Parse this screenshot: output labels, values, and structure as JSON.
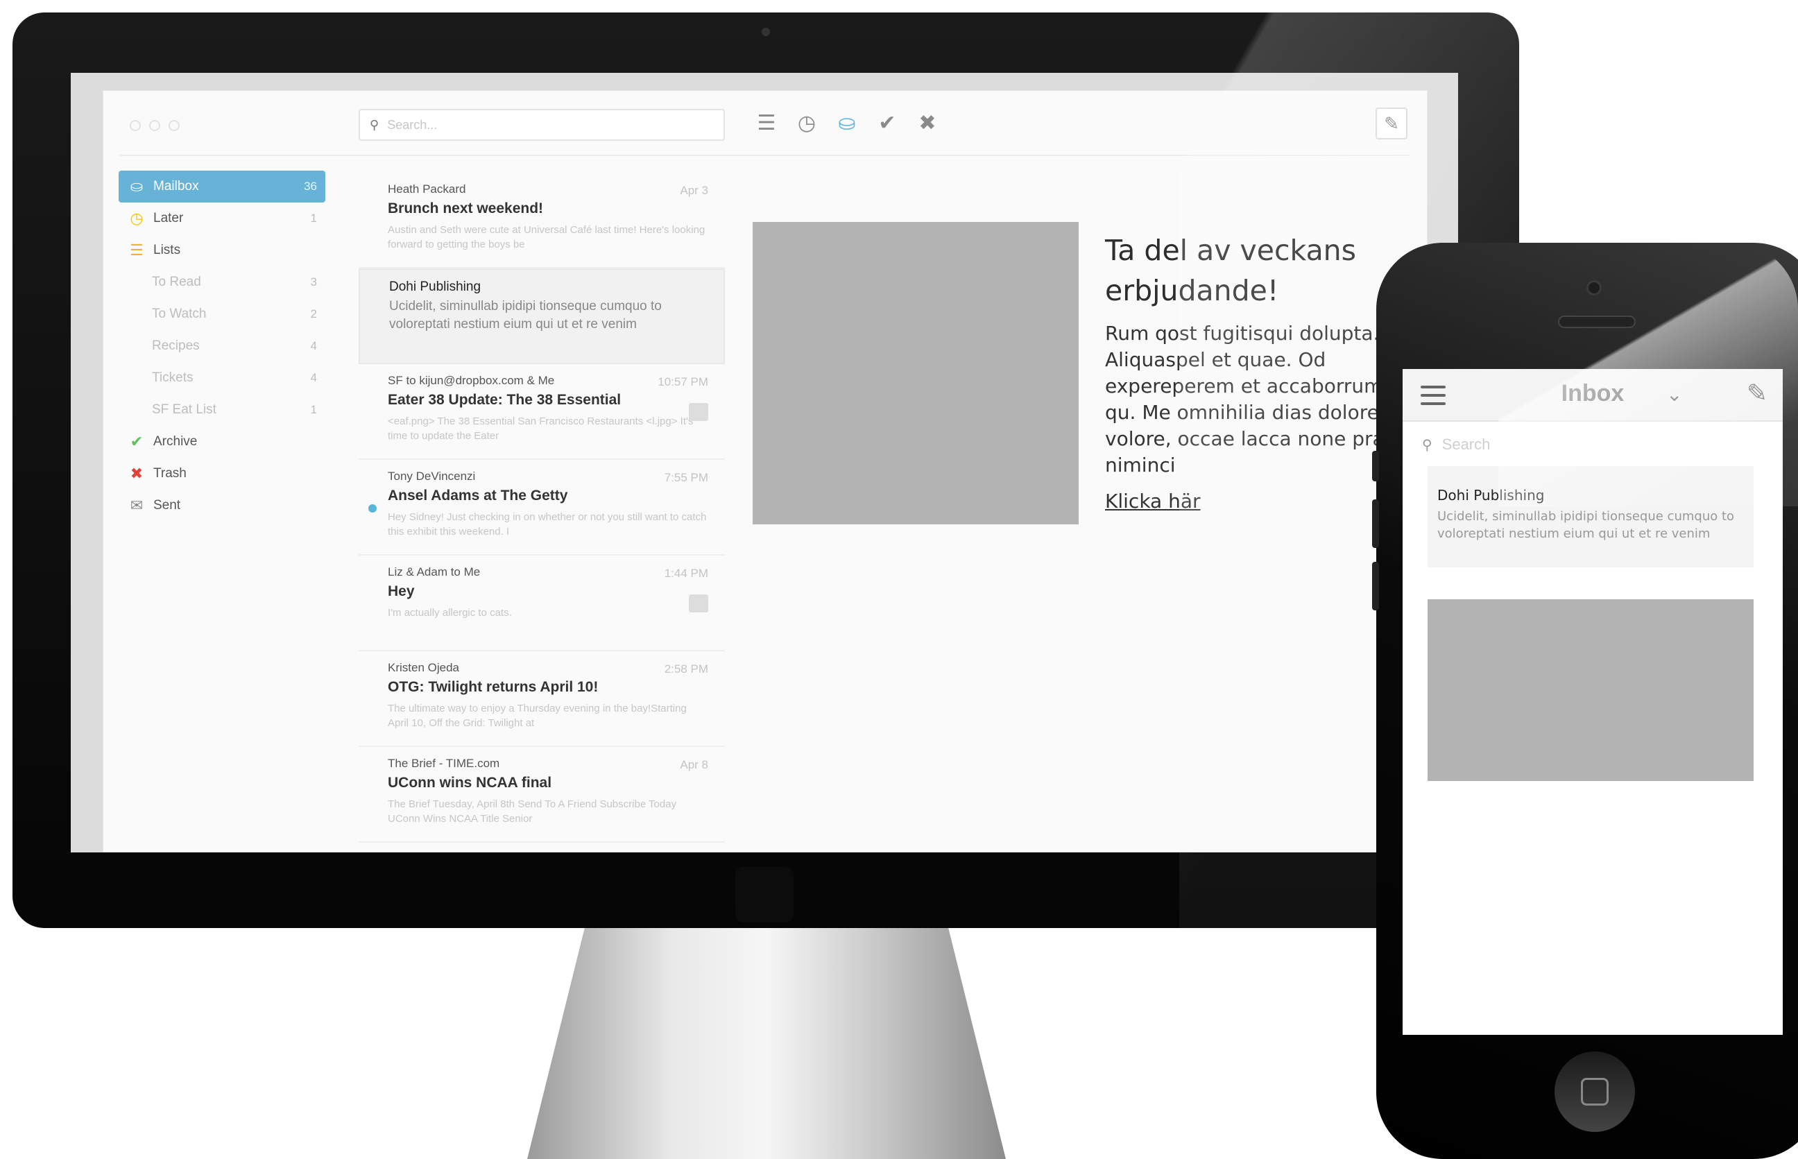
{
  "desktop": {
    "search_placeholder": "Search...",
    "sidebar": [
      {
        "label": "Mailbox",
        "count": "36",
        "icon": "inbox-icon",
        "glyph": "⛀",
        "color": "#ffffff",
        "active": true,
        "sub": false
      },
      {
        "label": "Later",
        "count": "1",
        "icon": "clock-icon",
        "glyph": "◷",
        "color": "#f2c300",
        "active": false,
        "sub": false
      },
      {
        "label": "Lists",
        "count": "",
        "icon": "list-icon",
        "glyph": "☰",
        "color": "#f0b23a",
        "active": false,
        "sub": false
      },
      {
        "label": "To Read",
        "count": "3",
        "icon": "",
        "glyph": "",
        "color": "",
        "active": false,
        "sub": true
      },
      {
        "label": "To Watch",
        "count": "2",
        "icon": "",
        "glyph": "",
        "color": "",
        "active": false,
        "sub": true
      },
      {
        "label": "Recipes",
        "count": "4",
        "icon": "",
        "glyph": "",
        "color": "",
        "active": false,
        "sub": true
      },
      {
        "label": "Tickets",
        "count": "4",
        "icon": "",
        "glyph": "",
        "color": "",
        "active": false,
        "sub": true
      },
      {
        "label": "SF Eat List",
        "count": "1",
        "icon": "",
        "glyph": "",
        "color": "",
        "active": false,
        "sub": true
      },
      {
        "label": "Archive",
        "count": "",
        "icon": "checkmark-icon",
        "glyph": "✔",
        "color": "#5cc15a",
        "active": false,
        "sub": false
      },
      {
        "label": "Trash",
        "count": "",
        "icon": "close-icon",
        "glyph": "✖",
        "color": "#e0423b",
        "active": false,
        "sub": false
      },
      {
        "label": "Sent",
        "count": "",
        "icon": "envelope-icon",
        "glyph": "✉",
        "color": "#888888",
        "active": false,
        "sub": false
      }
    ],
    "messages": [
      {
        "from": "Heath Packard",
        "time": "Apr 3",
        "subject": "Brunch next weekend!",
        "preview": "Austin and Seth were cute at Universal Café last time! Here's looking forward to getting the boys be",
        "selected": false,
        "badge": false,
        "unread": false
      },
      {
        "from": "Dohi Publishing",
        "time": "",
        "subject": "",
        "preview": "Ucidelit, siminullab ipidipi tionseque cumquo to voloreptati nestium eium qui ut et re venim",
        "selected": true,
        "badge": false,
        "unread": false
      },
      {
        "from": "SF to kijun@dropbox.com & Me",
        "time": "10:57 PM",
        "subject": "Eater 38 Update: The 38 Essential",
        "preview": "<eaf.png> The 38 Essential San Francisco Restaurants <l.jpg> It's time to update the Eater",
        "selected": false,
        "badge": true,
        "unread": false
      },
      {
        "from": "Tony DeVincenzi",
        "time": "7:55 PM",
        "subject": "Ansel Adams at The Getty",
        "preview": "Hey Sidney! Just checking in on whether or not you still want to catch this exhibit this weekend. I",
        "selected": false,
        "badge": false,
        "unread": true
      },
      {
        "from": "Liz & Adam to Me",
        "time": "1:44 PM",
        "subject": "Hey",
        "preview": "I'm actually allergic to cats.",
        "selected": false,
        "badge": true,
        "unread": false
      },
      {
        "from": "Kristen Ojeda",
        "time": "2:58 PM",
        "subject": "OTG: Twilight returns April 10!",
        "preview": "The ultimate way to enjoy a Thursday evening in the bay!Starting April 10, Off the Grid: Twilight at",
        "selected": false,
        "badge": false,
        "unread": false
      },
      {
        "from": "The Brief - TIME.com",
        "time": "Apr 8",
        "subject": "UConn wins NCAA final",
        "preview": "The Brief Tuesday, April 8th Send To A Friend Subscribe Today UConn Wins NCAA Title Senior",
        "selected": false,
        "badge": false,
        "unread": false
      }
    ],
    "reader": {
      "title": "Ta del av veckans erbjudande!",
      "body": "Rum qost fugitisqui dolupta. Aliquaspel et quae. Od expereperem et accaborrum qu. Me omnihilia dias dolorem volore, occae lacca none prae niminci",
      "link": "Klicka här"
    },
    "accent_color": "#67b3d8"
  },
  "mobile": {
    "title": "Inbox",
    "search_placeholder": "Search",
    "card_from": "Dohi Publishing",
    "card_preview": "Ucidelit, siminullab ipidipi tionseque cumquo to voloreptati nestium eium qui ut et re venim"
  }
}
